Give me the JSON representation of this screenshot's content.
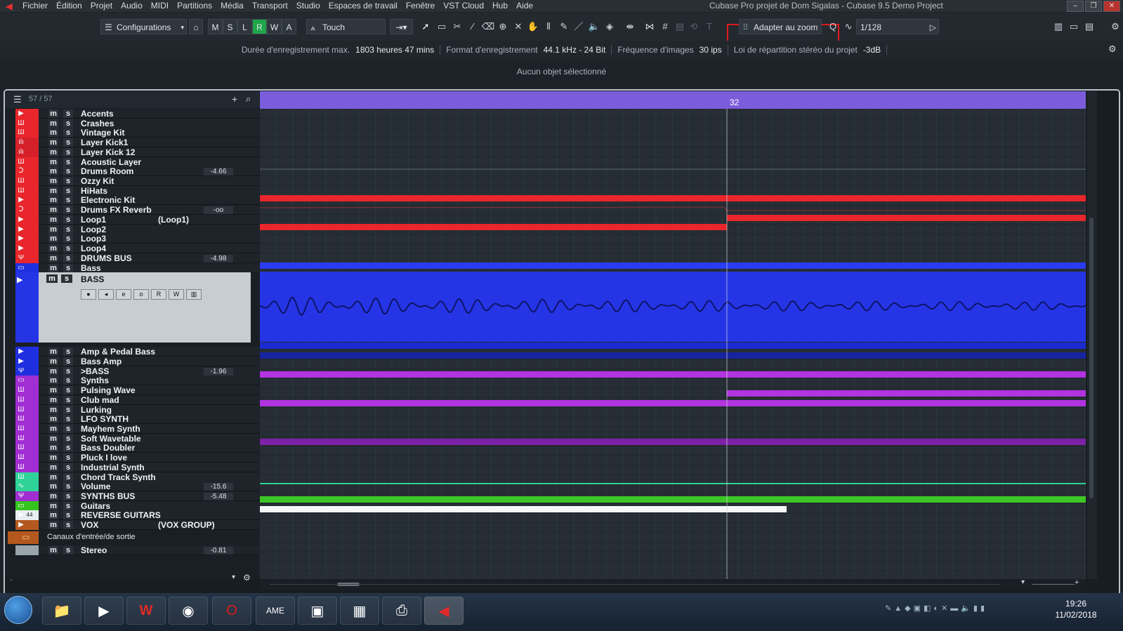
{
  "menu": {
    "items": [
      "Fichier",
      "Édition",
      "Projet",
      "Audio",
      "MIDI",
      "Partitions",
      "Média",
      "Transport",
      "Studio",
      "Espaces de travail",
      "Fenêtre",
      "VST Cloud",
      "Hub",
      "Aide"
    ],
    "window_title": "Cubase Pro projet de Dom Sigalas - Cubase 9.5 Demo Project"
  },
  "toolbar": {
    "configurations_label": "Configurations",
    "mode_buttons": [
      "M",
      "S",
      "L",
      "R",
      "W",
      "A"
    ],
    "automation_mode": "Touch",
    "snap_type": "Adapter au zoom",
    "quantize_value": "1/128"
  },
  "info": {
    "rec_time_label": "Durée d'enregistrement max.",
    "rec_time_value": "1803 heures 47 mins",
    "rec_format_label": "Format d'enregistrement",
    "rec_format_value": "44.1 kHz - 24 Bit",
    "framerate_label": "Fréquence d'images",
    "framerate_value": "30 ips",
    "panlaw_label": "Loi de répartition stéréo du projet",
    "panlaw_value": "-3dB"
  },
  "selection_status": "Aucun objet sélectionné",
  "tracklist": {
    "count": "57 / 57",
    "mute_label": "m",
    "solo_label": "s",
    "tracks": [
      {
        "name": "Accents",
        "color": "#e8262b",
        "icon": "audio"
      },
      {
        "name": "Crashes",
        "color": "#e8262b",
        "icon": "instrument"
      },
      {
        "name": "Vintage Kit",
        "color": "#e8262b",
        "icon": "instrument"
      },
      {
        "name": "Layer Kick1",
        "color": "#d5202a",
        "icon": "midi"
      },
      {
        "name": "Layer Kick 12",
        "color": "#d5202a",
        "icon": "midi"
      },
      {
        "name": "Acoustic Layer",
        "color": "#e8262b",
        "icon": "instrument"
      },
      {
        "name": "Drums Room",
        "color": "#e8262b",
        "icon": "fx",
        "volume": "-4.66"
      },
      {
        "name": "Ozzy Kit",
        "color": "#e8262b",
        "icon": "instrument"
      },
      {
        "name": "HiHats",
        "color": "#e8262b",
        "icon": "instrument"
      },
      {
        "name": "Electronic Kit",
        "color": "#e8262b",
        "icon": "audio"
      },
      {
        "name": "Drums FX Reverb",
        "color": "#e8262b",
        "icon": "fx",
        "volume": "-oo"
      },
      {
        "name": "Loop1",
        "extra": "(Loop1)",
        "color": "#e8262b",
        "icon": "audio"
      },
      {
        "name": "Loop2",
        "color": "#e8262b",
        "icon": "audio"
      },
      {
        "name": "Loop3",
        "color": "#e8262b",
        "icon": "audio"
      },
      {
        "name": "Loop4",
        "color": "#e8262b",
        "icon": "audio"
      },
      {
        "name": "DRUMS BUS",
        "color": "#e8262b",
        "icon": "group",
        "volume": "-4.98"
      },
      {
        "name": "Bass",
        "color": "#1f2fe0",
        "icon": "folder"
      }
    ],
    "bass_selected": {
      "name": "BASS",
      "color": "#2535e6",
      "record_buttons": [
        "●",
        "◂",
        "e",
        "o",
        "R",
        "W",
        "▥"
      ]
    },
    "tracks_after": [
      {
        "name": "Amp & Pedal Bass",
        "color": "#1f2fe0",
        "icon": "audio"
      },
      {
        "name": "Bass Amp",
        "color": "#1f2fe0",
        "icon": "audio"
      },
      {
        "name": ">BASS",
        "color": "#1f2fe0",
        "icon": "group",
        "volume": "-1.96"
      },
      {
        "name": "Synths",
        "color": "#a12ed2",
        "icon": "folder"
      },
      {
        "name": "Pulsing Wave",
        "color": "#a12ed2",
        "icon": "instrument"
      },
      {
        "name": "Club mad",
        "color": "#a12ed2",
        "icon": "instrument"
      },
      {
        "name": "Lurking",
        "color": "#a12ed2",
        "icon": "instrument"
      },
      {
        "name": "LFO SYNTH",
        "color": "#a12ed2",
        "icon": "instrument"
      },
      {
        "name": "Mayhem Synth",
        "color": "#a12ed2",
        "icon": "instrument"
      },
      {
        "name": "Soft Wavetable",
        "color": "#a12ed2",
        "icon": "instrument"
      },
      {
        "name": "Bass Doubler",
        "color": "#a12ed2",
        "icon": "instrument"
      },
      {
        "name": "Pluck I love",
        "color": "#a12ed2",
        "icon": "instrument"
      },
      {
        "name": "Industrial Synth",
        "color": "#a12ed2",
        "icon": "instrument"
      },
      {
        "name": "Chord Track Synth",
        "color": "#2fd39a",
        "icon": "instrument"
      },
      {
        "name": "Volume",
        "color": "#2fd39a",
        "icon": "automation",
        "volume": "-15.6"
      },
      {
        "name": "SYNTHS BUS",
        "color": "#a12ed2",
        "icon": "group",
        "volume": "-5.48"
      },
      {
        "name": "Guitars",
        "color": "#35c41f",
        "icon": "folder"
      },
      {
        "name": "REVERSE GUITARS",
        "color": "#e9eef2",
        "icon": "audio",
        "num": "44"
      },
      {
        "name": "VOX",
        "extra": "(VOX GROUP)",
        "color": "#b5581e",
        "icon": "audio"
      }
    ],
    "io_folder": "Canaux d'entrée/de sortie",
    "stereo": {
      "name": "Stereo",
      "volume": "-0.81"
    }
  },
  "ruler": {
    "bar_marker": "32"
  },
  "taskbar": {
    "time": "19:26",
    "date": "11/02/2018"
  },
  "colors": {
    "accent_red": "#e8262b",
    "bass_blue": "#2535e6",
    "synth_purple": "#a12ed2",
    "ruler": "#7b5ddb",
    "highlight_box": "#e0191c"
  }
}
